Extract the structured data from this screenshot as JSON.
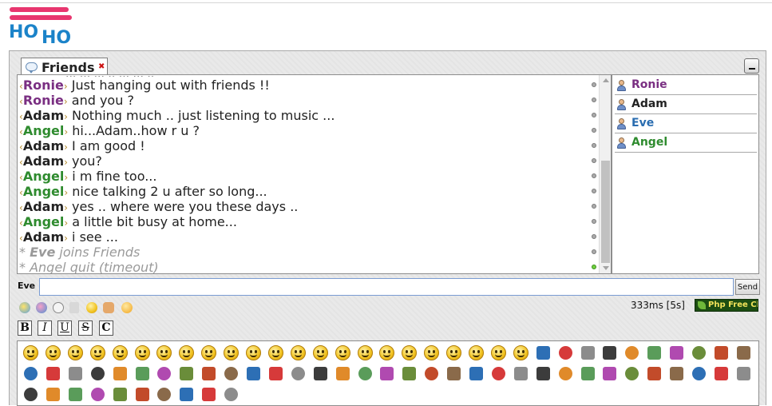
{
  "logo": {
    "line1": "HO",
    "line2": "HO"
  },
  "chat": {
    "tab_label": "Friends",
    "partial_line": "... ... ... .. ... ... ..",
    "messages": [
      {
        "nick": "Ronie",
        "text": "Just hanging out with friends !!",
        "color": "#7a2f82"
      },
      {
        "nick": "Ronie",
        "text": "and you ?",
        "color": "#7a2f82"
      },
      {
        "nick": "Adam",
        "text": "Nothing much .. just listening to music ...",
        "color": "#222222"
      },
      {
        "nick": "Angel",
        "text": "hi...Adam..how r u ?",
        "color": "#2e8b2e"
      },
      {
        "nick": "Adam",
        "text": "I am good !",
        "color": "#222222"
      },
      {
        "nick": "Adam",
        "text": "you?",
        "color": "#222222"
      },
      {
        "nick": "Angel",
        "text": "i m fine too...",
        "color": "#2e8b2e"
      },
      {
        "nick": "Angel",
        "text": "nice talking 2 u after so long...",
        "color": "#2e8b2e"
      },
      {
        "nick": "Adam",
        "text": "yes .. where were you these days ..",
        "color": "#222222"
      },
      {
        "nick": "Angel",
        "text": "a little bit busy at home...",
        "color": "#2e8b2e"
      },
      {
        "nick": "Adam",
        "text": "i see ...",
        "color": "#222222"
      }
    ],
    "system_messages": [
      {
        "prefix": "* ",
        "nick": "Eve",
        "text": " joins Friends"
      },
      {
        "prefix": "* ",
        "nick": "",
        "text": "Angel quit (timeout)"
      }
    ]
  },
  "users": [
    {
      "name": "Ronie",
      "color": "#7a2f82"
    },
    {
      "name": "Adam",
      "color": "#222222"
    },
    {
      "name": "Eve",
      "color": "#2a6db0"
    },
    {
      "name": "Angel",
      "color": "#2e8b2e"
    }
  ],
  "input": {
    "nick": "Eve",
    "value": "",
    "placeholder": "",
    "send_label": "Send"
  },
  "status": {
    "ping": "333ms [5s]",
    "badge": "Php Free Chat"
  },
  "format_buttons": [
    "B",
    "I",
    "U",
    "S",
    "C"
  ],
  "toolbar_icons": [
    "smiley-icon",
    "palette-icon",
    "clock-icon",
    "sound-icon",
    "smiley-toggle-icon",
    "user-list-icon",
    "clear-icon"
  ],
  "smiley_count": 76
}
